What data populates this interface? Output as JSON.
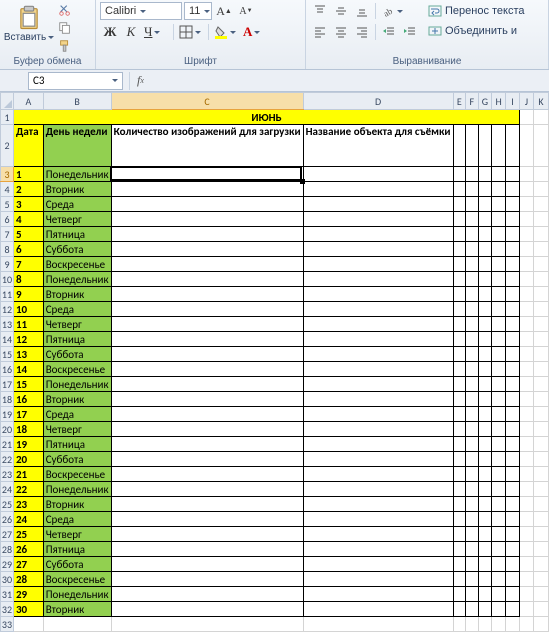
{
  "ribbon": {
    "clipboard": {
      "paste": "Вставить",
      "group": "Буфер обмена"
    },
    "font": {
      "name": "Calibri",
      "size": "11",
      "group": "Шрифт",
      "bold": "Ж",
      "italic": "К",
      "underline": "Ч"
    },
    "align": {
      "group": "Выравнивание",
      "wrap": "Перенос текста",
      "merge": "Объединить и"
    }
  },
  "namebox": "C3",
  "sheet": {
    "cols": [
      "A",
      "B",
      "C",
      "D",
      "E",
      "F",
      "G",
      "H",
      "I",
      "J",
      "K"
    ],
    "title": "ИЮНЬ",
    "headers": {
      "A": "Дата",
      "B": "День недели",
      "C": "Количество изображений для загрузки",
      "D": "Название объекта для съёмки"
    },
    "rows": [
      {
        "n": 1,
        "d": "Понедельник"
      },
      {
        "n": 2,
        "d": "Вторник"
      },
      {
        "n": 3,
        "d": "Среда"
      },
      {
        "n": 4,
        "d": "Четверг"
      },
      {
        "n": 5,
        "d": "Пятница"
      },
      {
        "n": 6,
        "d": "Суббота"
      },
      {
        "n": 7,
        "d": "Воскресенье"
      },
      {
        "n": 8,
        "d": "Понедельник"
      },
      {
        "n": 9,
        "d": "Вторник"
      },
      {
        "n": 10,
        "d": "Среда"
      },
      {
        "n": 11,
        "d": "Четверг"
      },
      {
        "n": 12,
        "d": "Пятница"
      },
      {
        "n": 13,
        "d": "Суббота"
      },
      {
        "n": 14,
        "d": "Воскресенье"
      },
      {
        "n": 15,
        "d": "Понедельник"
      },
      {
        "n": 16,
        "d": "Вторник"
      },
      {
        "n": 17,
        "d": "Среда"
      },
      {
        "n": 18,
        "d": "Четверг"
      },
      {
        "n": 19,
        "d": "Пятница"
      },
      {
        "n": 20,
        "d": "Суббота"
      },
      {
        "n": 21,
        "d": "Воскресенье"
      },
      {
        "n": 22,
        "d": "Понедельник"
      },
      {
        "n": 23,
        "d": "Вторник"
      },
      {
        "n": 24,
        "d": "Среда"
      },
      {
        "n": 25,
        "d": "Четверг"
      },
      {
        "n": 26,
        "d": "Пятница"
      },
      {
        "n": 27,
        "d": "Суббота"
      },
      {
        "n": 28,
        "d": "Воскресенье"
      },
      {
        "n": 29,
        "d": "Понедельник"
      },
      {
        "n": 30,
        "d": "Вторник"
      }
    ]
  }
}
